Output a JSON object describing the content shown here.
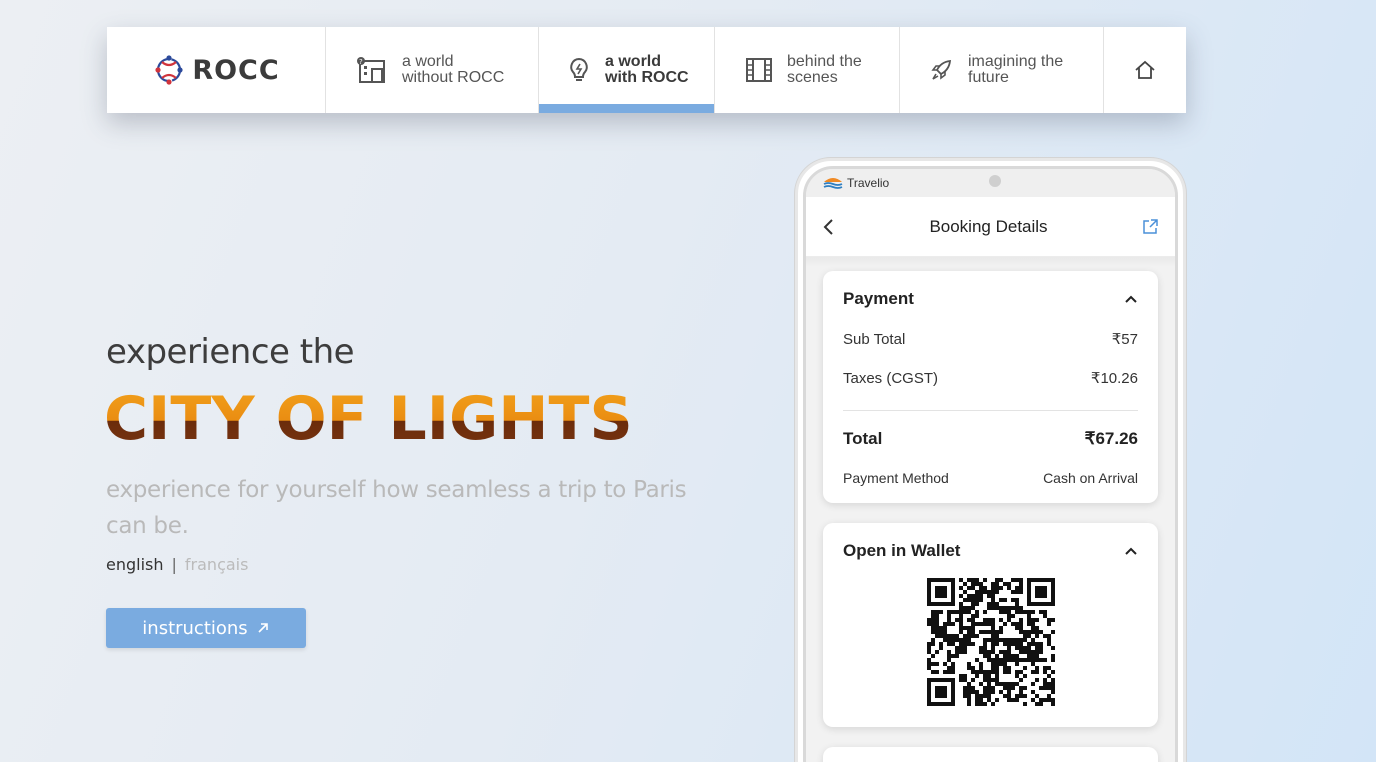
{
  "nav": {
    "logo_text": "ROCC",
    "items": [
      {
        "line1": "a world",
        "line2": "without ROCC",
        "icon": "building-question-icon"
      },
      {
        "line1": "a world",
        "line2": "with ROCC",
        "icon": "lightbulb-icon",
        "active": true
      },
      {
        "line1": "behind the",
        "line2": "scenes",
        "icon": "film-icon"
      },
      {
        "line1": "imagining the",
        "line2": "future",
        "icon": "rocket-icon"
      }
    ],
    "home_icon": "home-icon"
  },
  "hero": {
    "kicker": "experience the",
    "title": "CITY OF LIGHTS",
    "subtitle": "experience for yourself how seamless a trip to Paris can be.",
    "lang_english": "english",
    "lang_sep": "|",
    "lang_french": "français",
    "button_label": "instructions"
  },
  "phone": {
    "brand": "Travelio",
    "screen_title": "Booking Details",
    "payment": {
      "title": "Payment",
      "sub_total_label": "Sub Total",
      "sub_total_value": "₹57",
      "taxes_label": "Taxes (CGST)",
      "taxes_value": "₹10.26",
      "total_label": "Total",
      "total_value": "₹67.26",
      "method_label": "Payment Method",
      "method_value": "Cash on Arrival"
    },
    "wallet": {
      "title": "Open in Wallet"
    }
  },
  "colors": {
    "accent": "#7aabe0",
    "title_orange": "#ea8d12",
    "title_brown": "#6b2c0c"
  }
}
